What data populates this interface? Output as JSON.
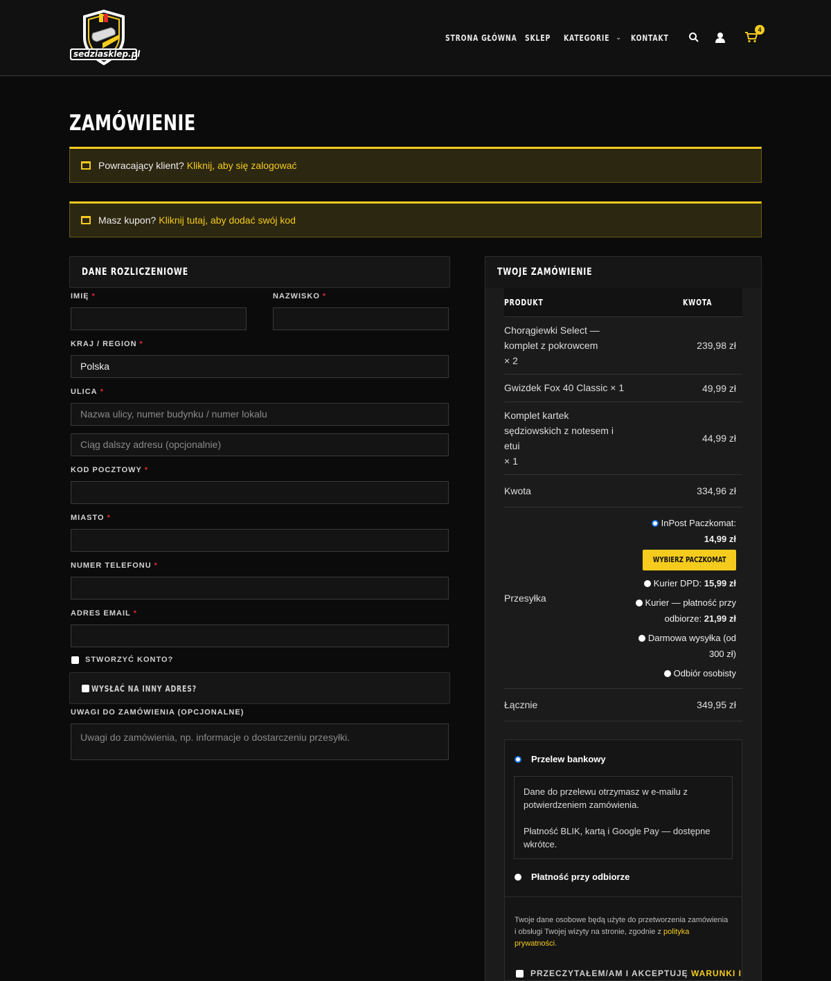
{
  "header": {
    "logo_text": "sedziasklep.pl",
    "nav": [
      "STRONA GŁÓWNA",
      "SKLEP",
      "KATEGORIE",
      "KONTAKT"
    ],
    "cart_count": "4"
  },
  "page_title": "ZAMÓWIENIE",
  "notices": {
    "login": {
      "text": "Powracający klient?",
      "link": "Kliknij, aby się zalogować"
    },
    "coupon": {
      "text": "Masz kupon?",
      "link": "Kliknij tutaj, aby dodać swój kod"
    }
  },
  "billing": {
    "title": "DANE ROZLICZENIOWE",
    "first_name_label": "IMIĘ",
    "last_name_label": "NAZWISKO",
    "country_label": "KRAJ / REGION",
    "country_value": "Polska",
    "street_label": "ULICA",
    "street_placeholder": "Nazwa ulicy, numer budynku / numer lokalu",
    "street2_placeholder": "Ciąg dalszy adresu (opcjonalnie)",
    "postcode_label": "KOD POCZTOWY",
    "city_label": "MIASTO",
    "phone_label": "NUMER TELEFONU",
    "email_label": "ADRES EMAIL",
    "required_mark": "*",
    "create_account": "STWORZYĆ KONTO?",
    "ship_different": "WYSŁAĆ NA INNY ADRES?",
    "notes_label": "UWAGI DO ZAMÓWIENIA (OPCJONALNE)",
    "notes_placeholder": "Uwagi do zamówienia, np. informacje o dostarczeniu przesyłki."
  },
  "order": {
    "title": "TWOJE ZAMÓWIENIE",
    "col_product": "PRODUKT",
    "col_amount": "KWOTA",
    "items": [
      {
        "name": "Chorągiewki Select — komplet z pokrowcem",
        "qty": "× 2",
        "amount": "239,98 zł"
      },
      {
        "name": "Gwizdek Fox 40 Classic",
        "qty": "× 1",
        "amount": "49,99 zł"
      },
      {
        "name": "Komplet kartek sędziowskich z notesem i etui",
        "qty": "× 1",
        "amount": "44,99 zł"
      }
    ],
    "subtotal_label": "Kwota",
    "subtotal": "334,96 zł",
    "shipping_label": "Przesyłka",
    "shipping": {
      "inpost_label": "InPost Paczkomat:",
      "inpost_price": "14,99 zł",
      "pick_button": "WYBIERZ PACZKOMAT",
      "dpd_label": "Kurier DPD:",
      "dpd_price": "15,99 zł",
      "cod_label_1": "Kurier — płatność przy",
      "cod_label_2": "odbiorze:",
      "cod_price": "21,99 zł",
      "free_label_1": "Darmowa wysyłka (od",
      "free_label_2": "300 zł)",
      "pickup_label": "Odbiór osobisty"
    },
    "total_label": "Łącznie",
    "total": "349,95 zł"
  },
  "payment": {
    "bank_label": "Przelew bankowy",
    "bank_desc_1": "Dane do przelewu otrzymasz w e-mailu z potwierdzeniem zamówienia.",
    "bank_desc_2": "Płatność BLIK, kartą i Google Pay — dostępne wkrótce.",
    "cod_label": "Płatność przy odbiorze",
    "privacy_text": "Twoje dane osobowe będą użyte do przetworzenia zamówienia i obsługi Twojej wizyty na stronie, zgodnie z",
    "privacy_link": "polityka prywatności",
    "privacy_end": ".",
    "terms_text": "PRZECZYTAŁEM/AM I AKCEPTUJĘ",
    "terms_link": "WARUNKI I"
  },
  "colors": {
    "accent": "#f5cc1d",
    "background": "#0b0b0b",
    "required": "#e02b2b"
  }
}
